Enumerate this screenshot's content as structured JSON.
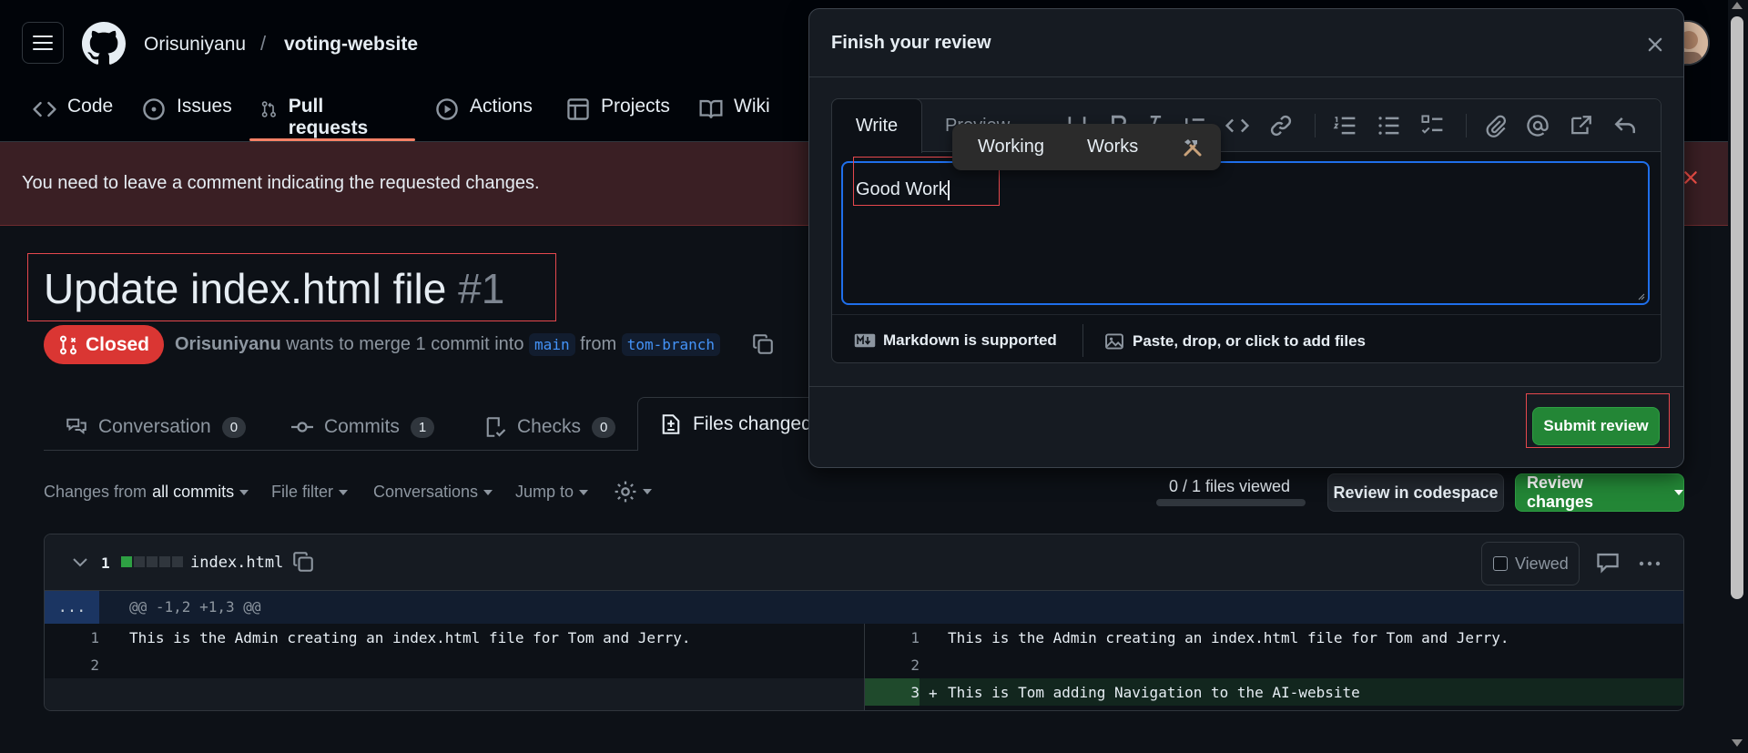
{
  "header": {
    "owner": "Orisuniyanu",
    "separator": "/",
    "repo": "voting-website",
    "nav": [
      {
        "label": "Code",
        "icon": "code-icon"
      },
      {
        "label": "Issues",
        "icon": "issue-opened-icon"
      },
      {
        "label": "Pull requests",
        "icon": "git-pull-request-icon",
        "active": true
      },
      {
        "label": "Actions",
        "icon": "play-icon"
      },
      {
        "label": "Projects",
        "icon": "table-icon"
      },
      {
        "label": "Wiki",
        "icon": "book-icon"
      }
    ]
  },
  "flash": {
    "message": "You need to leave a comment indicating the requested changes."
  },
  "pr": {
    "title": "Update index.html file",
    "number": "#1",
    "state": "Closed",
    "author": "Orisuniyanu",
    "meta_middle": "wants to merge 1 commit into",
    "base_branch": "main",
    "meta_from": "from",
    "head_branch": "tom-branch"
  },
  "tabs": [
    {
      "label": "Conversation",
      "count": "0"
    },
    {
      "label": "Commits",
      "count": "1"
    },
    {
      "label": "Checks",
      "count": "0"
    },
    {
      "label": "Files changed"
    }
  ],
  "toolbar": {
    "changes_prefix": "Changes from",
    "changes_value": "all commits",
    "file_filter": "File filter",
    "conversations": "Conversations",
    "jump_to": "Jump to",
    "files_viewed": "0 / 1 files viewed",
    "review_codespace": "Review in codespace",
    "review_changes": "Review changes"
  },
  "diff": {
    "count": "1",
    "filename": "index.html",
    "viewed_label": "Viewed",
    "hunk_ellipsis": "...",
    "hunk_header": "@@ -1,2 +1,3 @@",
    "left": [
      {
        "num": "1",
        "text": "This is the Admin creating an index.html file for Tom and Jerry."
      },
      {
        "num": "2",
        "text": ""
      }
    ],
    "right": [
      {
        "num": "1",
        "text": "This is the Admin creating an index.html file for Tom and Jerry."
      },
      {
        "num": "2",
        "text": ""
      },
      {
        "num": "3",
        "marker": "+",
        "text": "This is Tom adding Navigation to the AI-website"
      }
    ]
  },
  "dialog": {
    "title": "Finish your review",
    "write_tab": "Write",
    "preview_tab": "Preview",
    "comment_value": "Good Work",
    "markdown_note": "Markdown is supported",
    "attach_note": "Paste, drop, or click to add files",
    "submit": "Submit review"
  },
  "suggestions": [
    "Working",
    "Works"
  ],
  "colors": {
    "accent_red": "#da3633",
    "accent_green": "#238636",
    "link_blue": "#4493f8",
    "underline": "#f78166"
  }
}
